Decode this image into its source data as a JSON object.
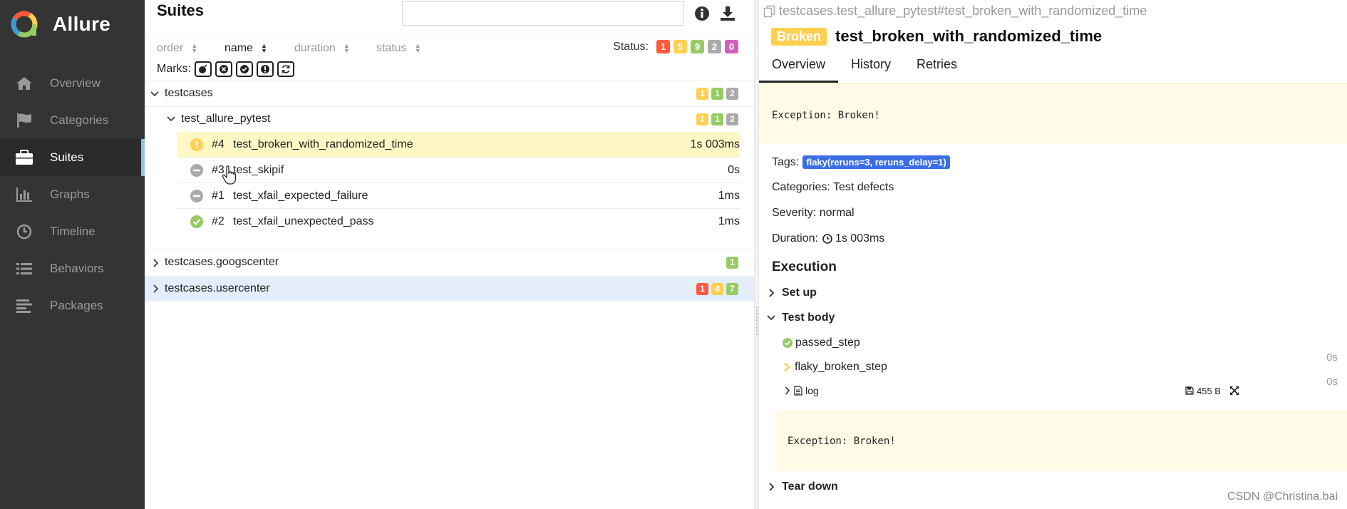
{
  "sidebar": {
    "brand": "Allure",
    "items": [
      {
        "label": "Overview",
        "icon": "home-icon"
      },
      {
        "label": "Categories",
        "icon": "flag-icon"
      },
      {
        "label": "Suites",
        "icon": "briefcase-icon",
        "active": true
      },
      {
        "label": "Graphs",
        "icon": "bar-chart-icon"
      },
      {
        "label": "Timeline",
        "icon": "clock-icon"
      },
      {
        "label": "Behaviors",
        "icon": "list-icon"
      },
      {
        "label": "Packages",
        "icon": "align-left-icon"
      }
    ]
  },
  "suites": {
    "title": "Suites",
    "search_value": "",
    "sort": {
      "order": "order",
      "name": "name",
      "duration": "duration",
      "status": "status"
    },
    "status_label": "Status:",
    "status_counts": {
      "failed": "1",
      "broken": "5",
      "passed": "9",
      "skipped": "2",
      "unknown": "0"
    },
    "marks_label": "Marks:",
    "tree": [
      {
        "name": "testcases",
        "expanded": true,
        "badges": {
          "broken": "1",
          "passed": "1",
          "skipped": "2"
        },
        "children": [
          {
            "name": "test_allure_pytest",
            "expanded": true,
            "badges": {
              "broken": "1",
              "passed": "1",
              "skipped": "2"
            },
            "tests": [
              {
                "num": "#4",
                "title": "test_broken_with_randomized_time",
                "duration": "1s 003ms",
                "status": "broken",
                "selected": true
              },
              {
                "num": "#3",
                "title": "test_skipif",
                "duration": "0s",
                "status": "skipped"
              },
              {
                "num": "#1",
                "title": "test_xfail_expected_failure",
                "duration": "1ms",
                "status": "skipped"
              },
              {
                "num": "#2",
                "title": "test_xfail_unexpected_pass",
                "duration": "1ms",
                "status": "passed"
              }
            ]
          }
        ]
      },
      {
        "name": "testcases.googscenter",
        "expanded": false,
        "badges": {
          "passed": "1"
        }
      },
      {
        "name": "testcases.usercenter",
        "expanded": false,
        "badges": {
          "failed": "1",
          "broken": "4",
          "passed": "7"
        }
      }
    ]
  },
  "result": {
    "breadcrumb": "testcases.test_allure_pytest#test_broken_with_randomized_time",
    "status": "Broken",
    "title": "test_broken_with_randomized_time",
    "tabs": [
      "Overview",
      "History",
      "Retries"
    ],
    "exception": "Exception: Broken!",
    "tags_label": "Tags:",
    "tag": "flaky(reruns=3, reruns_delay=1)",
    "categories": "Categories: Test defects",
    "severity": "Severity: normal",
    "duration_label": "Duration:",
    "duration": "1s 003ms",
    "execution_title": "Execution",
    "setup": "Set up",
    "test_body": "Test body",
    "steps": [
      {
        "name": "passed_step",
        "duration": "0s"
      },
      {
        "name": "flaky_broken_step",
        "duration": "0s"
      }
    ],
    "attachment": {
      "name": "log",
      "size": "455 B"
    },
    "attachment_content": "Exception: Broken!",
    "teardown": "Tear down"
  },
  "watermark": "CSDN @Christina.bai",
  "colors": {
    "failed": "#fd5a3e",
    "broken": "#ffd050",
    "passed": "#97cc64",
    "skipped": "#aaaaaa",
    "unknown": "#d35ebe",
    "sidebar": "#343434"
  }
}
